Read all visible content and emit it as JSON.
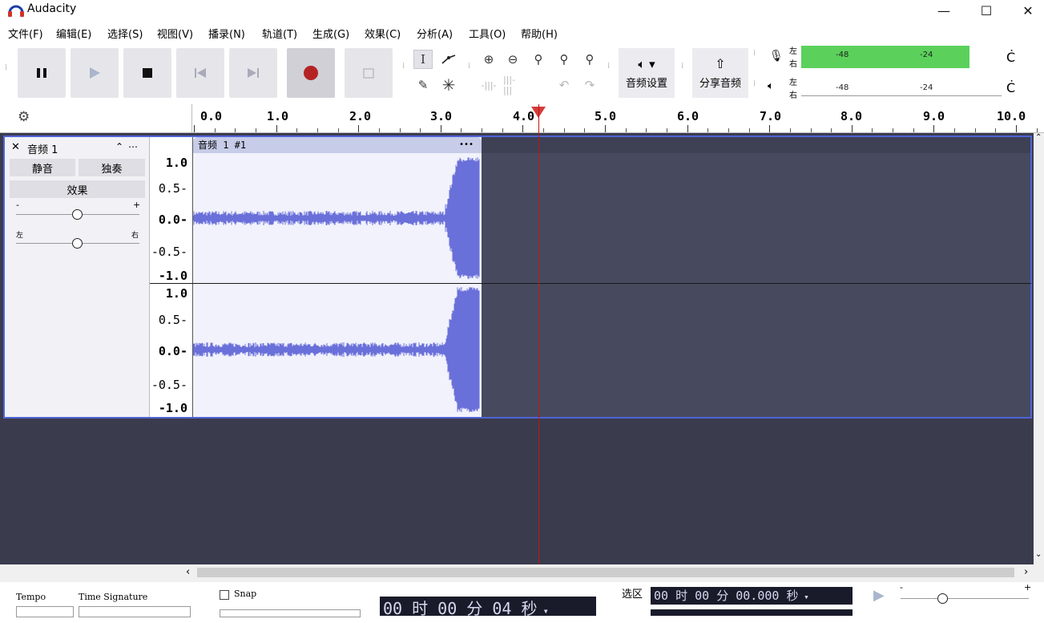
{
  "window": {
    "title": "Audacity",
    "minimize": "—",
    "maximize": "☐",
    "close": "✕"
  },
  "menu": [
    "文件(F)",
    "编辑(E)",
    "选择(S)",
    "视图(V)",
    "播录(N)",
    "轨道(T)",
    "生成(G)",
    "效果(C)",
    "分析(A)",
    "工具(O)",
    "帮助(H)"
  ],
  "toolbar": {
    "audio_setup_label": "音频设置",
    "share_audio_label": "分享音频"
  },
  "meters": {
    "record_left": "左",
    "record_right": "右",
    "play_left": "左",
    "play_right": "右",
    "scale_48": "-48",
    "scale_24": "-24",
    "record_level_green": "#5bd15b"
  },
  "ruler": {
    "labels": [
      "0.0",
      "1.0",
      "2.0",
      "3.0",
      "4.0",
      "5.0",
      "6.0",
      "7.0",
      "8.0",
      "9.0",
      "10.0"
    ]
  },
  "track": {
    "name": "音频 1",
    "mute_label": "静音",
    "solo_label": "独奏",
    "effects_label": "效果",
    "gain_minus": "-",
    "gain_plus": "+",
    "pan_left": "左",
    "pan_right": "右",
    "clip_name": "音频 1 #1",
    "clip_menu": "•••",
    "scale_top": [
      "1.0",
      "0.5-",
      "0.0-",
      "-0.5-",
      "-1.0"
    ],
    "scale_bottom": [
      "1.0",
      "0.5-",
      "0.0-",
      "-0.5-",
      "-1.0"
    ],
    "waveform_color": "#6a70d9",
    "selection_border": "#4f64d6"
  },
  "bottom": {
    "tempo_label": "Tempo",
    "time_sig_label": "Time Signature",
    "snap_label": "Snap",
    "time_display": "00 时 00 分 04 秒",
    "selection_label": "选区",
    "selection_start": "00 时 00 分 00.000 秒"
  }
}
